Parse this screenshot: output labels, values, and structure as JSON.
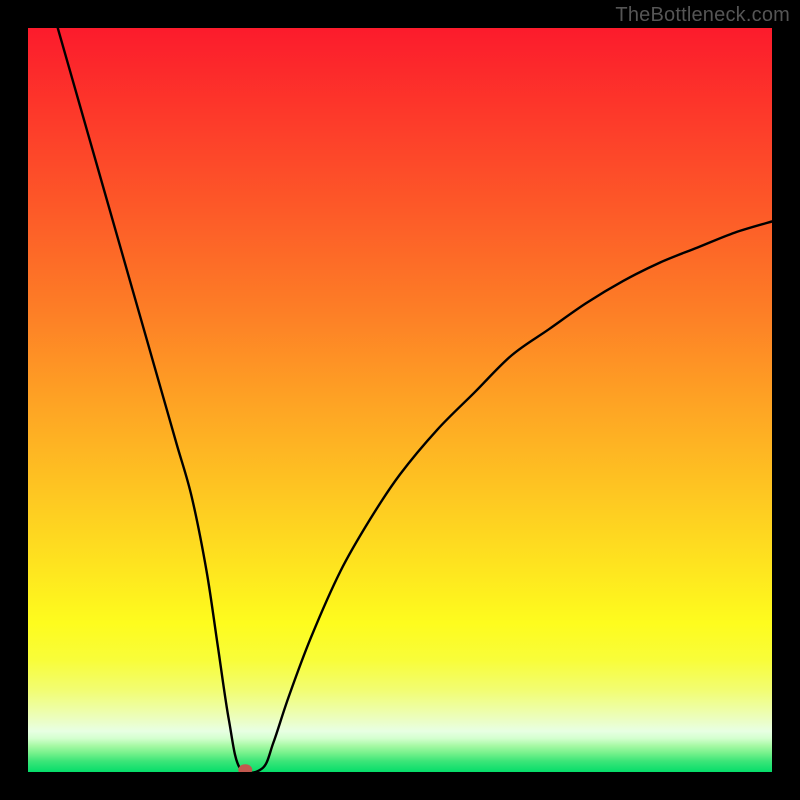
{
  "attribution": "TheBottleneck.com",
  "colors": {
    "black": "#000000",
    "curve": "#000000",
    "marker": "#c1584e"
  },
  "gradient_stops": [
    {
      "offset": 0.0,
      "color": "#fc1b2c"
    },
    {
      "offset": 0.12,
      "color": "#fd3a2a"
    },
    {
      "offset": 0.25,
      "color": "#fd5b28"
    },
    {
      "offset": 0.38,
      "color": "#fd7e26"
    },
    {
      "offset": 0.5,
      "color": "#fea224"
    },
    {
      "offset": 0.62,
      "color": "#fec522"
    },
    {
      "offset": 0.72,
      "color": "#fee31f"
    },
    {
      "offset": 0.8,
      "color": "#fefc1e"
    },
    {
      "offset": 0.85,
      "color": "#f8fd3a"
    },
    {
      "offset": 0.89,
      "color": "#f2fd72"
    },
    {
      "offset": 0.92,
      "color": "#edfeae"
    },
    {
      "offset": 0.945,
      "color": "#e8ffe3"
    },
    {
      "offset": 0.955,
      "color": "#d3ffce"
    },
    {
      "offset": 0.965,
      "color": "#a5f9a4"
    },
    {
      "offset": 0.975,
      "color": "#74f18b"
    },
    {
      "offset": 0.985,
      "color": "#3ee679"
    },
    {
      "offset": 1.0,
      "color": "#05dd6a"
    }
  ],
  "chart_data": {
    "type": "line",
    "title": "",
    "xlabel": "",
    "ylabel": "",
    "xlim": [
      0,
      100
    ],
    "ylim": [
      0,
      100
    ],
    "series": [
      {
        "name": "curve",
        "x": [
          4,
          6,
          8,
          10,
          12,
          14,
          16,
          18,
          20,
          22,
          24,
          25.5,
          27,
          28.5,
          31.5,
          33,
          35,
          38,
          42,
          46,
          50,
          55,
          60,
          65,
          70,
          75,
          80,
          85,
          90,
          95,
          100
        ],
        "y": [
          100,
          93,
          86,
          79,
          72,
          65,
          58,
          51,
          44,
          37,
          27,
          17,
          7,
          0.5,
          0.5,
          4,
          10,
          18,
          27,
          34,
          40,
          46,
          51,
          56,
          59.5,
          63,
          66,
          68.5,
          70.5,
          72.5,
          74
        ]
      }
    ],
    "marker": {
      "x": 29.2,
      "y": 0.3
    },
    "grid": false,
    "legend": false
  }
}
